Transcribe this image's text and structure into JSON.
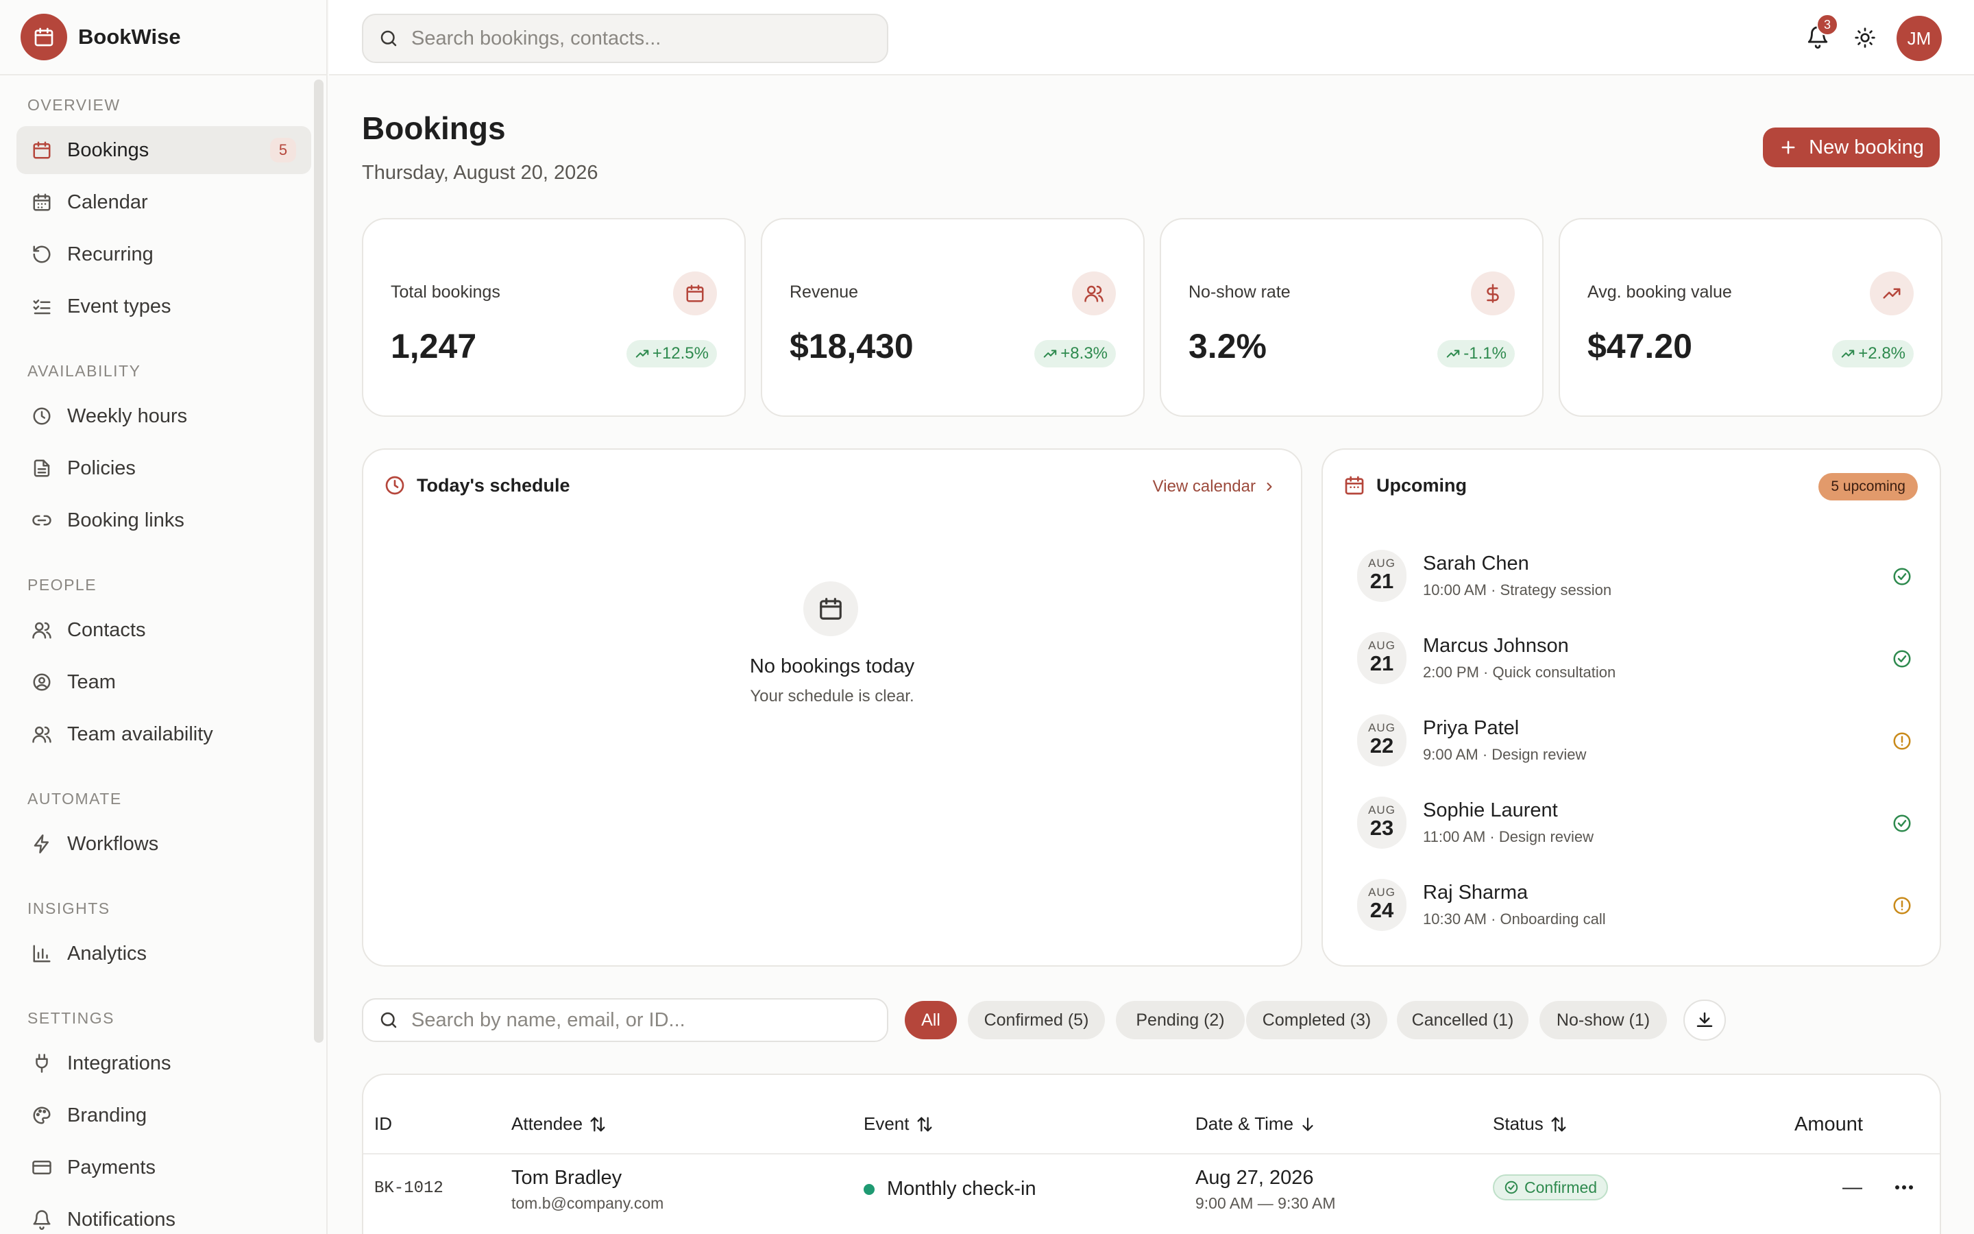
{
  "app": {
    "name": "BookWise",
    "logo_icon": "calendar-icon"
  },
  "colors": {
    "accent": "#b5463b",
    "success": "#2e8a4e",
    "warning": "#c98a1a",
    "upcoming_pill": "#e29a6b"
  },
  "topbar": {
    "search_placeholder": "Search bookings, contacts...",
    "notifications_count": "3",
    "user_initials": "JM"
  },
  "sidebar": {
    "sections": {
      "overview": "OVERVIEW",
      "availability": "AVAILABILITY",
      "people": "PEOPLE",
      "automate": "AUTOMATE",
      "insights": "INSIGHTS",
      "settings": "SETTINGS"
    },
    "items": {
      "bookings": {
        "label": "Bookings",
        "badge": "5",
        "icon": "calendar-icon",
        "active": true
      },
      "calendar": {
        "label": "Calendar",
        "icon": "calendar-grid-icon"
      },
      "recurring": {
        "label": "Recurring",
        "icon": "rotate-icon"
      },
      "event_types": {
        "label": "Event types",
        "icon": "list-check-icon"
      },
      "weekly_hours": {
        "label": "Weekly hours",
        "icon": "clock-icon"
      },
      "policies": {
        "label": "Policies",
        "icon": "document-icon"
      },
      "booking_links": {
        "label": "Booking links",
        "icon": "link-icon"
      },
      "contacts": {
        "label": "Contacts",
        "icon": "users-icon"
      },
      "team": {
        "label": "Team",
        "icon": "user-circle-icon"
      },
      "team_availability": {
        "label": "Team availability",
        "icon": "users-icon"
      },
      "workflows": {
        "label": "Workflows",
        "icon": "bolt-icon"
      },
      "analytics": {
        "label": "Analytics",
        "icon": "bar-chart-icon"
      },
      "integrations": {
        "label": "Integrations",
        "icon": "plug-icon"
      },
      "branding": {
        "label": "Branding",
        "icon": "palette-icon"
      },
      "payments": {
        "label": "Payments",
        "icon": "credit-card-icon"
      },
      "notifications": {
        "label": "Notifications",
        "icon": "bell-icon"
      }
    }
  },
  "page": {
    "title": "Bookings",
    "date": "Thursday, August 20, 2026",
    "new_button": "New booking"
  },
  "stats": [
    {
      "label": "Total bookings",
      "value": "1,247",
      "trend": "+12.5%",
      "icon": "calendar-icon"
    },
    {
      "label": "Revenue",
      "value": "$18,430",
      "trend": "+8.3%",
      "icon": "users-icon"
    },
    {
      "label": "No-show rate",
      "value": "3.2%",
      "trend": "-1.1%",
      "icon": "dollar-icon"
    },
    {
      "label": "Avg. booking value",
      "value": "$47.20",
      "trend": "+2.8%",
      "icon": "trending-up-icon"
    }
  ],
  "schedule": {
    "title": "Today's schedule",
    "view_link": "View calendar",
    "empty_title": "No bookings today",
    "empty_sub": "Your schedule is clear."
  },
  "upcoming": {
    "title": "Upcoming",
    "pill": "5 upcoming",
    "items": [
      {
        "month": "AUG",
        "day": "21",
        "name": "Sarah Chen",
        "meta": "10:00 AM · Strategy session",
        "status": "confirmed"
      },
      {
        "month": "AUG",
        "day": "21",
        "name": "Marcus Johnson",
        "meta": "2:00 PM · Quick consultation",
        "status": "confirmed"
      },
      {
        "month": "AUG",
        "day": "22",
        "name": "Priya Patel",
        "meta": "9:00 AM · Design review",
        "status": "pending"
      },
      {
        "month": "AUG",
        "day": "23",
        "name": "Sophie Laurent",
        "meta": "11:00 AM · Design review",
        "status": "confirmed"
      },
      {
        "month": "AUG",
        "day": "24",
        "name": "Raj Sharma",
        "meta": "10:30 AM · Onboarding call",
        "status": "pending"
      }
    ]
  },
  "filters": {
    "search_placeholder": "Search by name, email, or ID...",
    "chips": [
      "All",
      "Confirmed (5)",
      "Pending (2)",
      "Completed (3)",
      "Cancelled (1)",
      "No-show (1)"
    ],
    "active": "All"
  },
  "table": {
    "columns": [
      "ID",
      "Attendee",
      "Event",
      "Date & Time",
      "Status",
      "Amount"
    ],
    "rows": [
      {
        "id": "BK-1012",
        "name": "Tom Bradley",
        "email": "tom.b@company.com",
        "event": "Monthly check-in",
        "date": "Aug 27, 2026",
        "time": "9:00 AM — 9:30 AM",
        "status": "Confirmed",
        "amount": "—"
      }
    ]
  }
}
